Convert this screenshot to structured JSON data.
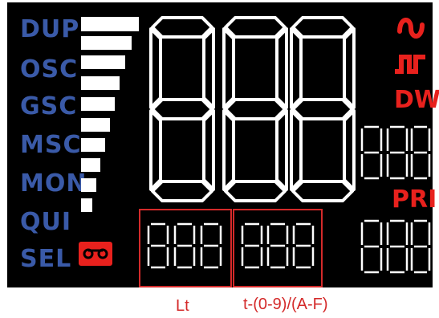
{
  "modes": [
    "DUP",
    "OSC",
    "GSC",
    "MSC",
    "MON",
    "QUI",
    "SEL"
  ],
  "right_labels": {
    "dw": "DW",
    "pri": "PRI"
  },
  "captions": {
    "lt": "Lt",
    "t_range": "t-(0-9)/(A-F)"
  },
  "colors": {
    "panel": "#000000",
    "mode_text": "#3a5aa8",
    "accent_red": "#e8211d",
    "segment": "#ffffff"
  },
  "icons": [
    "sine-wave-icon",
    "square-wave-icon",
    "cassette-tape-icon"
  ]
}
